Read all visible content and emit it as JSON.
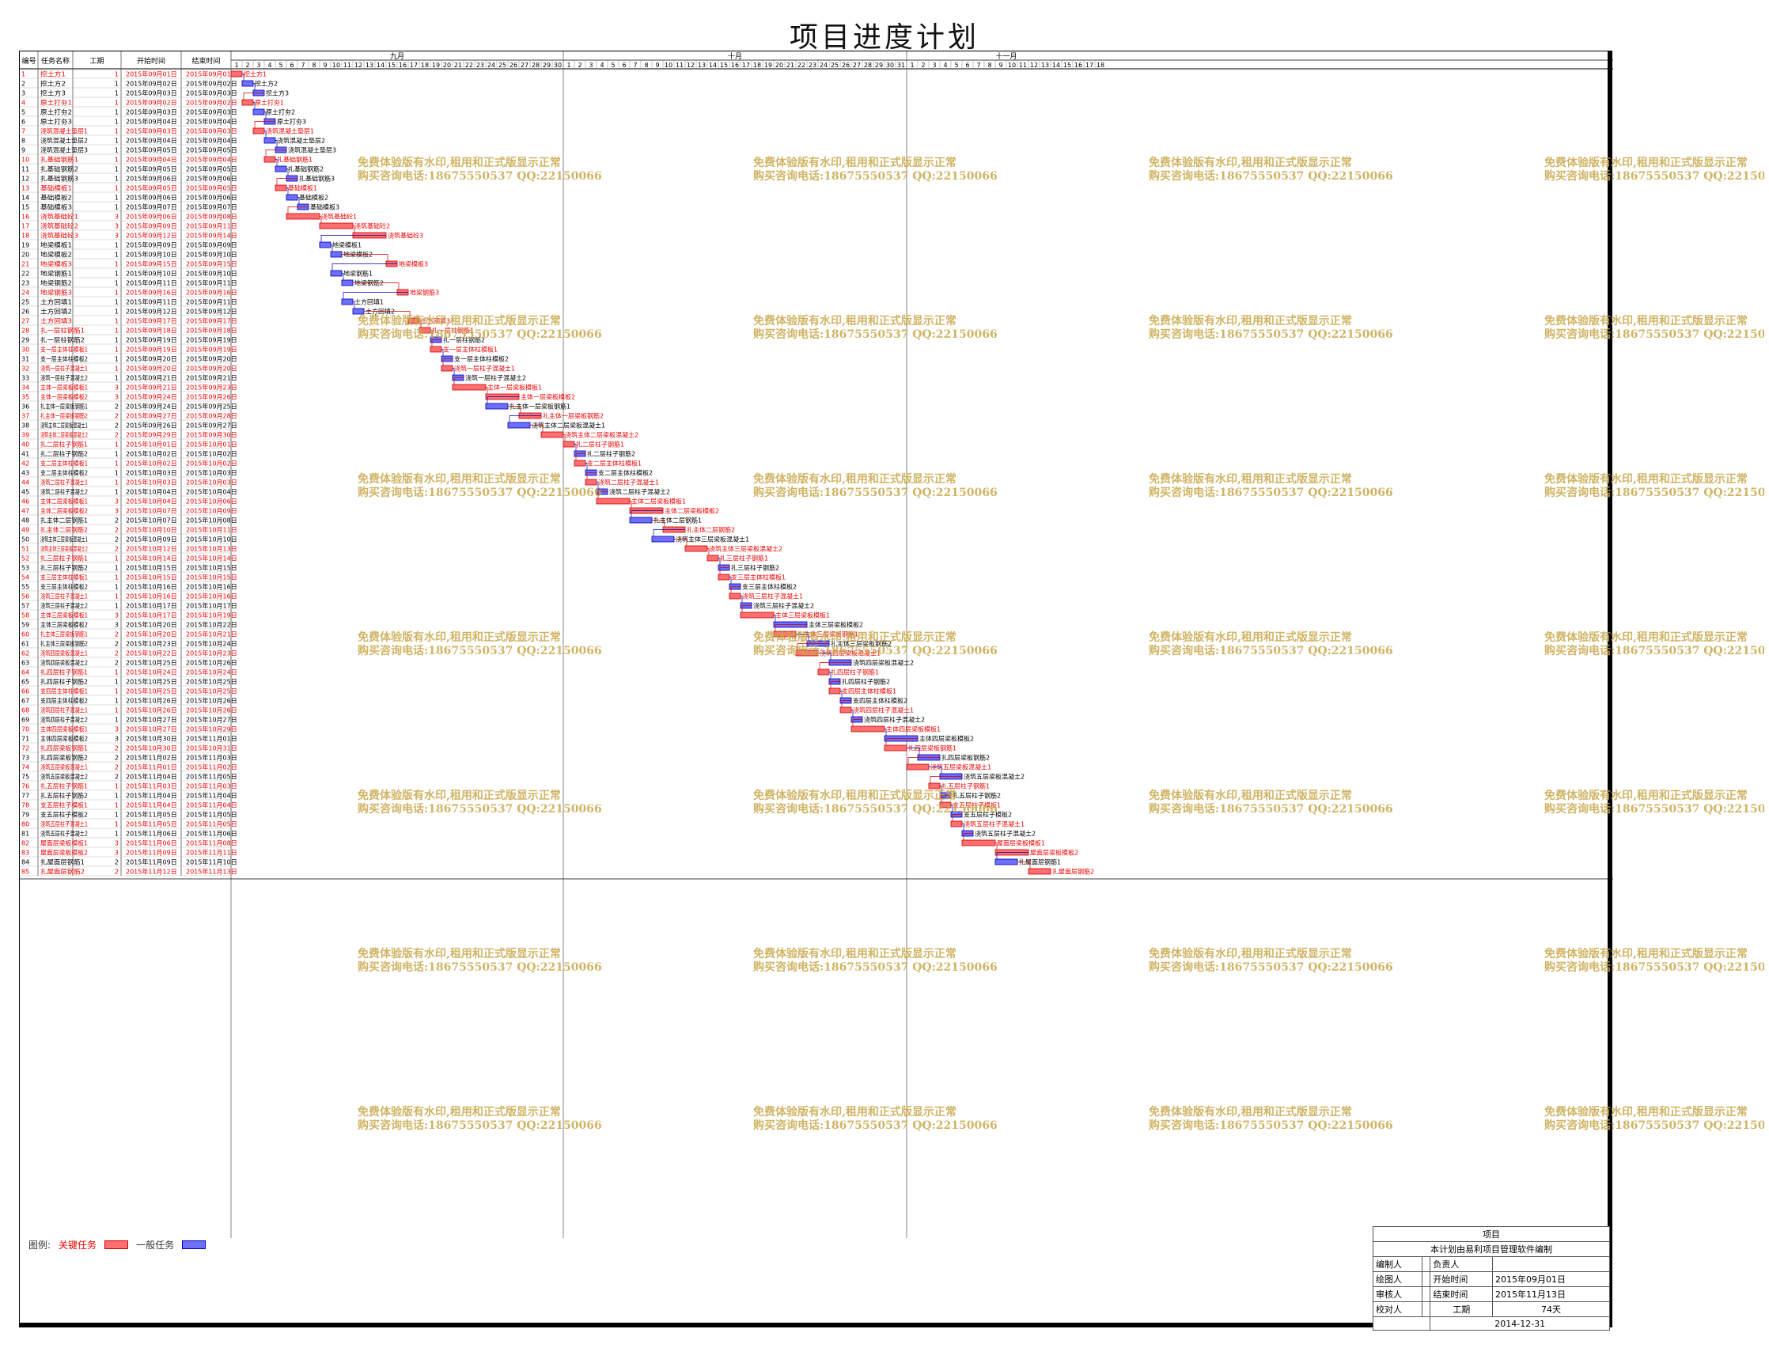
{
  "page_title": "项目进度计划",
  "columns": {
    "id": "编号",
    "name": "任务名称",
    "duration": "工期",
    "start": "开始时间",
    "end": "结束时间"
  },
  "months": [
    "九月",
    "十月",
    "十一月"
  ],
  "legend": {
    "label": "图例:",
    "critical": "关键任务",
    "normal": "一般任务"
  },
  "title_block": {
    "project_label": "项目",
    "note": "本计划由易利项目管理软件编制",
    "editor_label": "编制人",
    "owner_label": "负责人",
    "drawer_label": "绘图人",
    "start_label": "开始时间",
    "start_value": "2015年09月01日",
    "reviewer_label": "审核人",
    "end_label": "结束时间",
    "end_value": "2015年11月13日",
    "checker_label": "校对人",
    "duration_label": "工期",
    "duration_value": "74天",
    "date": "2014-12-31"
  },
  "watermark": {
    "line1": "免费体验版有水印,租用和正式版显示正常",
    "line2": "购买咨询电话:18675550537 QQ:22150066"
  },
  "colors": {
    "critical": "#ff6f6f",
    "critical_border": "#cc0000",
    "critical_text": "#ee0000",
    "normal": "#6f6fff",
    "normal_border": "#0000aa",
    "normal_text": "#000000",
    "watermark": "#c8a84b"
  },
  "chart_data": {
    "type": "gantt",
    "timeline_start": "2015-09-01",
    "timeline_end": "2015-11-18",
    "tasks": [
      {
        "id": 1,
        "name": "挖土方1",
        "dur": 1,
        "start": "2015年09月01日",
        "end": "2015年09月01日",
        "crit": true
      },
      {
        "id": 2,
        "name": "挖土方2",
        "dur": 1,
        "start": "2015年09月02日",
        "end": "2015年09月02日",
        "crit": false
      },
      {
        "id": 3,
        "name": "挖土方3",
        "dur": 1,
        "start": "2015年09月03日",
        "end": "2015年09月03日",
        "crit": false
      },
      {
        "id": 4,
        "name": "原土打夯1",
        "dur": 1,
        "start": "2015年09月02日",
        "end": "2015年09月02日",
        "crit": true
      },
      {
        "id": 5,
        "name": "原土打夯2",
        "dur": 1,
        "start": "2015年09月03日",
        "end": "2015年09月03日",
        "crit": false
      },
      {
        "id": 6,
        "name": "原土打夯3",
        "dur": 1,
        "start": "2015年09月04日",
        "end": "2015年09月04日",
        "crit": false
      },
      {
        "id": 7,
        "name": "浇筑混凝土垫层1",
        "dur": 1,
        "start": "2015年09月03日",
        "end": "2015年09月03日",
        "crit": true
      },
      {
        "id": 8,
        "name": "浇筑混凝土垫层2",
        "dur": 1,
        "start": "2015年09月04日",
        "end": "2015年09月04日",
        "crit": false
      },
      {
        "id": 9,
        "name": "浇筑混凝土垫层3",
        "dur": 1,
        "start": "2015年09月05日",
        "end": "2015年09月05日",
        "crit": false
      },
      {
        "id": 10,
        "name": "扎基础钢筋1",
        "dur": 1,
        "start": "2015年09月04日",
        "end": "2015年09月04日",
        "crit": true
      },
      {
        "id": 11,
        "name": "扎基础钢筋2",
        "dur": 1,
        "start": "2015年09月05日",
        "end": "2015年09月05日",
        "crit": false
      },
      {
        "id": 12,
        "name": "扎基础钢筋3",
        "dur": 1,
        "start": "2015年09月06日",
        "end": "2015年09月06日",
        "crit": false
      },
      {
        "id": 13,
        "name": "基础模板1",
        "dur": 1,
        "start": "2015年09月05日",
        "end": "2015年09月05日",
        "crit": true
      },
      {
        "id": 14,
        "name": "基础模板2",
        "dur": 1,
        "start": "2015年09月06日",
        "end": "2015年09月06日",
        "crit": false
      },
      {
        "id": 15,
        "name": "基础模板3",
        "dur": 1,
        "start": "2015年09月07日",
        "end": "2015年09月07日",
        "crit": false
      },
      {
        "id": 16,
        "name": "浇筑基础砼1",
        "dur": 3,
        "start": "2015年09月06日",
        "end": "2015年09月08日",
        "crit": true
      },
      {
        "id": 17,
        "name": "浇筑基础砼2",
        "dur": 3,
        "start": "2015年09月09日",
        "end": "2015年09月11日",
        "crit": true
      },
      {
        "id": 18,
        "name": "浇筑基础砼3",
        "dur": 3,
        "start": "2015年09月12日",
        "end": "2015年09月14日",
        "crit": true
      },
      {
        "id": 19,
        "name": "地梁模板1",
        "dur": 1,
        "start": "2015年09月09日",
        "end": "2015年09月09日",
        "crit": false
      },
      {
        "id": 20,
        "name": "地梁模板2",
        "dur": 1,
        "start": "2015年09月10日",
        "end": "2015年09月10日",
        "crit": false
      },
      {
        "id": 21,
        "name": "地梁模板3",
        "dur": 1,
        "start": "2015年09月15日",
        "end": "2015年09月15日",
        "crit": true
      },
      {
        "id": 22,
        "name": "地梁钢筋1",
        "dur": 1,
        "start": "2015年09月10日",
        "end": "2015年09月10日",
        "crit": false
      },
      {
        "id": 23,
        "name": "地梁钢筋2",
        "dur": 1,
        "start": "2015年09月11日",
        "end": "2015年09月11日",
        "crit": false
      },
      {
        "id": 24,
        "name": "地梁钢筋3",
        "dur": 1,
        "start": "2015年09月16日",
        "end": "2015年09月16日",
        "crit": true
      },
      {
        "id": 25,
        "name": "土方回填1",
        "dur": 1,
        "start": "2015年09月11日",
        "end": "2015年09月11日",
        "crit": false
      },
      {
        "id": 26,
        "name": "土方回填2",
        "dur": 1,
        "start": "2015年09月12日",
        "end": "2015年09月12日",
        "crit": false
      },
      {
        "id": 27,
        "name": "土方回填3",
        "dur": 1,
        "start": "2015年09月17日",
        "end": "2015年09月17日",
        "crit": true
      },
      {
        "id": 28,
        "name": "扎一层柱钢筋1",
        "dur": 1,
        "start": "2015年09月18日",
        "end": "2015年09月18日",
        "crit": true
      },
      {
        "id": 29,
        "name": "扎一层柱钢筋2",
        "dur": 1,
        "start": "2015年09月19日",
        "end": "2015年09月19日",
        "crit": false
      },
      {
        "id": 30,
        "name": "支一层主体柱模板1",
        "dur": 1,
        "start": "2015年09月19日",
        "end": "2015年09月19日",
        "crit": true
      },
      {
        "id": 31,
        "name": "支一层主体柱模板2",
        "dur": 1,
        "start": "2015年09月20日",
        "end": "2015年09月20日",
        "crit": false
      },
      {
        "id": 32,
        "name": "浇筑一层柱子混凝土1",
        "dur": 1,
        "start": "2015年09月20日",
        "end": "2015年09月20日",
        "crit": true
      },
      {
        "id": 33,
        "name": "浇筑一层柱子混凝土2",
        "dur": 1,
        "start": "2015年09月21日",
        "end": "2015年09月21日",
        "crit": false
      },
      {
        "id": 34,
        "name": "主体一层梁板模板1",
        "dur": 3,
        "start": "2015年09月21日",
        "end": "2015年09月23日",
        "crit": true
      },
      {
        "id": 35,
        "name": "主体一层梁板模板2",
        "dur": 3,
        "start": "2015年09月24日",
        "end": "2015年09月26日",
        "crit": true
      },
      {
        "id": 36,
        "name": "扎主体一层梁板钢筋1",
        "dur": 2,
        "start": "2015年09月24日",
        "end": "2015年09月25日",
        "crit": false
      },
      {
        "id": 37,
        "name": "扎主体一层梁板钢筋2",
        "dur": 2,
        "start": "2015年09月27日",
        "end": "2015年09月28日",
        "crit": true
      },
      {
        "id": 38,
        "name": "浇筑主体二层梁板混凝土1",
        "dur": 2,
        "start": "2015年09月26日",
        "end": "2015年09月27日",
        "crit": false
      },
      {
        "id": 39,
        "name": "浇筑主体二层梁板混凝土2",
        "dur": 2,
        "start": "2015年09月29日",
        "end": "2015年09月30日",
        "crit": true
      },
      {
        "id": 40,
        "name": "扎二层柱子钢筋1",
        "dur": 1,
        "start": "2015年10月01日",
        "end": "2015年10月01日",
        "crit": true
      },
      {
        "id": 41,
        "name": "扎二层柱子钢筋2",
        "dur": 1,
        "start": "2015年10月02日",
        "end": "2015年10月02日",
        "crit": false
      },
      {
        "id": 42,
        "name": "支二层主体柱模板1",
        "dur": 1,
        "start": "2015年10月02日",
        "end": "2015年10月02日",
        "crit": true
      },
      {
        "id": 43,
        "name": "支二层主体柱模板2",
        "dur": 1,
        "start": "2015年10月03日",
        "end": "2015年10月03日",
        "crit": false
      },
      {
        "id": 44,
        "name": "浇筑二层柱子混凝土1",
        "dur": 1,
        "start": "2015年10月03日",
        "end": "2015年10月03日",
        "crit": true
      },
      {
        "id": 45,
        "name": "浇筑二层柱子混凝土2",
        "dur": 1,
        "start": "2015年10月04日",
        "end": "2015年10月04日",
        "crit": false
      },
      {
        "id": 46,
        "name": "主体二层梁板模板1",
        "dur": 3,
        "start": "2015年10月04日",
        "end": "2015年10月06日",
        "crit": true
      },
      {
        "id": 47,
        "name": "主体二层梁板模板2",
        "dur": 3,
        "start": "2015年10月07日",
        "end": "2015年10月09日",
        "crit": true
      },
      {
        "id": 48,
        "name": "扎主体二层钢筋1",
        "dur": 2,
        "start": "2015年10月07日",
        "end": "2015年10月08日",
        "crit": false
      },
      {
        "id": 49,
        "name": "扎主体二层钢筋2",
        "dur": 2,
        "start": "2015年10月10日",
        "end": "2015年10月11日",
        "crit": true
      },
      {
        "id": 50,
        "name": "浇筑主体三层梁板混凝土1",
        "dur": 2,
        "start": "2015年10月09日",
        "end": "2015年10月10日",
        "crit": false
      },
      {
        "id": 51,
        "name": "浇筑主体三层梁板混凝土2",
        "dur": 2,
        "start": "2015年10月12日",
        "end": "2015年10月13日",
        "crit": true
      },
      {
        "id": 52,
        "name": "扎三层柱子钢筋1",
        "dur": 1,
        "start": "2015年10月14日",
        "end": "2015年10月14日",
        "crit": true
      },
      {
        "id": 53,
        "name": "扎三层柱子钢筋2",
        "dur": 1,
        "start": "2015年10月15日",
        "end": "2015年10月15日",
        "crit": false
      },
      {
        "id": 54,
        "name": "支三层主体柱模板1",
        "dur": 1,
        "start": "2015年10月15日",
        "end": "2015年10月15日",
        "crit": true
      },
      {
        "id": 55,
        "name": "支三层主体柱模板2",
        "dur": 1,
        "start": "2015年10月16日",
        "end": "2015年10月16日",
        "crit": false
      },
      {
        "id": 56,
        "name": "浇筑三层柱子混凝土1",
        "dur": 1,
        "start": "2015年10月16日",
        "end": "2015年10月16日",
        "crit": true
      },
      {
        "id": 57,
        "name": "浇筑三层柱子混凝土2",
        "dur": 1,
        "start": "2015年10月17日",
        "end": "2015年10月17日",
        "crit": false
      },
      {
        "id": 58,
        "name": "主体三层梁板模板1",
        "dur": 3,
        "start": "2015年10月17日",
        "end": "2015年10月19日",
        "crit": true
      },
      {
        "id": 59,
        "name": "主体三层梁板模板2",
        "dur": 3,
        "start": "2015年10月20日",
        "end": "2015年10月22日",
        "crit": false
      },
      {
        "id": 60,
        "name": "扎主体三层梁板钢筋1",
        "dur": 2,
        "start": "2015年10月20日",
        "end": "2015年10月21日",
        "crit": true
      },
      {
        "id": 61,
        "name": "扎主体三层梁板钢筋2",
        "dur": 2,
        "start": "2015年10月23日",
        "end": "2015年10月24日",
        "crit": false
      },
      {
        "id": 62,
        "name": "浇筑四层梁板混凝土1",
        "dur": 2,
        "start": "2015年10月22日",
        "end": "2015年10月23日",
        "crit": true
      },
      {
        "id": 63,
        "name": "浇筑四层梁板混凝土2",
        "dur": 2,
        "start": "2015年10月25日",
        "end": "2015年10月26日",
        "crit": false
      },
      {
        "id": 64,
        "name": "扎四层柱子钢筋1",
        "dur": 1,
        "start": "2015年10月24日",
        "end": "2015年10月24日",
        "crit": true
      },
      {
        "id": 65,
        "name": "扎四层柱子钢筋2",
        "dur": 1,
        "start": "2015年10月25日",
        "end": "2015年10月25日",
        "crit": false
      },
      {
        "id": 66,
        "name": "支四层主体柱模板1",
        "dur": 1,
        "start": "2015年10月25日",
        "end": "2015年10月25日",
        "crit": true
      },
      {
        "id": 67,
        "name": "支四层主体柱模板2",
        "dur": 1,
        "start": "2015年10月26日",
        "end": "2015年10月26日",
        "crit": false
      },
      {
        "id": 68,
        "name": "浇筑四层柱子混凝土1",
        "dur": 1,
        "start": "2015年10月26日",
        "end": "2015年10月26日",
        "crit": true
      },
      {
        "id": 69,
        "name": "浇筑四层柱子混凝土2",
        "dur": 1,
        "start": "2015年10月27日",
        "end": "2015年10月27日",
        "crit": false
      },
      {
        "id": 70,
        "name": "主体四层梁板模板1",
        "dur": 3,
        "start": "2015年10月27日",
        "end": "2015年10月29日",
        "crit": true
      },
      {
        "id": 71,
        "name": "主体四层梁板模板2",
        "dur": 3,
        "start": "2015年10月30日",
        "end": "2015年11月01日",
        "crit": false
      },
      {
        "id": 72,
        "name": "扎四层梁板钢筋1",
        "dur": 2,
        "start": "2015年10月30日",
        "end": "2015年10月31日",
        "crit": true
      },
      {
        "id": 73,
        "name": "扎四层梁板钢筋2",
        "dur": 2,
        "start": "2015年11月02日",
        "end": "2015年11月03日",
        "crit": false
      },
      {
        "id": 74,
        "name": "浇筑五层梁板混凝土1",
        "dur": 2,
        "start": "2015年11月01日",
        "end": "2015年11月02日",
        "crit": true
      },
      {
        "id": 75,
        "name": "浇筑五层梁板混凝土2",
        "dur": 2,
        "start": "2015年11月04日",
        "end": "2015年11月05日",
        "crit": false
      },
      {
        "id": 76,
        "name": "扎五层柱子钢筋1",
        "dur": 1,
        "start": "2015年11月03日",
        "end": "2015年11月03日",
        "crit": true
      },
      {
        "id": 77,
        "name": "扎五层柱子钢筋2",
        "dur": 1,
        "start": "2015年11月04日",
        "end": "2015年11月04日",
        "crit": false
      },
      {
        "id": 78,
        "name": "支五层柱子模板1",
        "dur": 1,
        "start": "2015年11月04日",
        "end": "2015年11月04日",
        "crit": true
      },
      {
        "id": 79,
        "name": "支五层柱子模板2",
        "dur": 1,
        "start": "2015年11月05日",
        "end": "2015年11月05日",
        "crit": false
      },
      {
        "id": 80,
        "name": "浇筑五层柱子混凝土1",
        "dur": 1,
        "start": "2015年11月05日",
        "end": "2015年11月05日",
        "crit": true
      },
      {
        "id": 81,
        "name": "浇筑五层柱子混凝土2",
        "dur": 1,
        "start": "2015年11月06日",
        "end": "2015年11月06日",
        "crit": false
      },
      {
        "id": 82,
        "name": "屋面层梁板模板1",
        "dur": 3,
        "start": "2015年11月06日",
        "end": "2015年11月08日",
        "crit": true
      },
      {
        "id": 83,
        "name": "屋面层梁板模板2",
        "dur": 3,
        "start": "2015年11月09日",
        "end": "2015年11月11日",
        "crit": true
      },
      {
        "id": 84,
        "name": "扎屋面层钢筋1",
        "dur": 2,
        "start": "2015年11月09日",
        "end": "2015年11月10日",
        "crit": false
      },
      {
        "id": 85,
        "name": "扎屋面层钢筋2",
        "dur": 2,
        "start": "2015年11月12日",
        "end": "2015年11月13日",
        "crit": true
      }
    ]
  }
}
